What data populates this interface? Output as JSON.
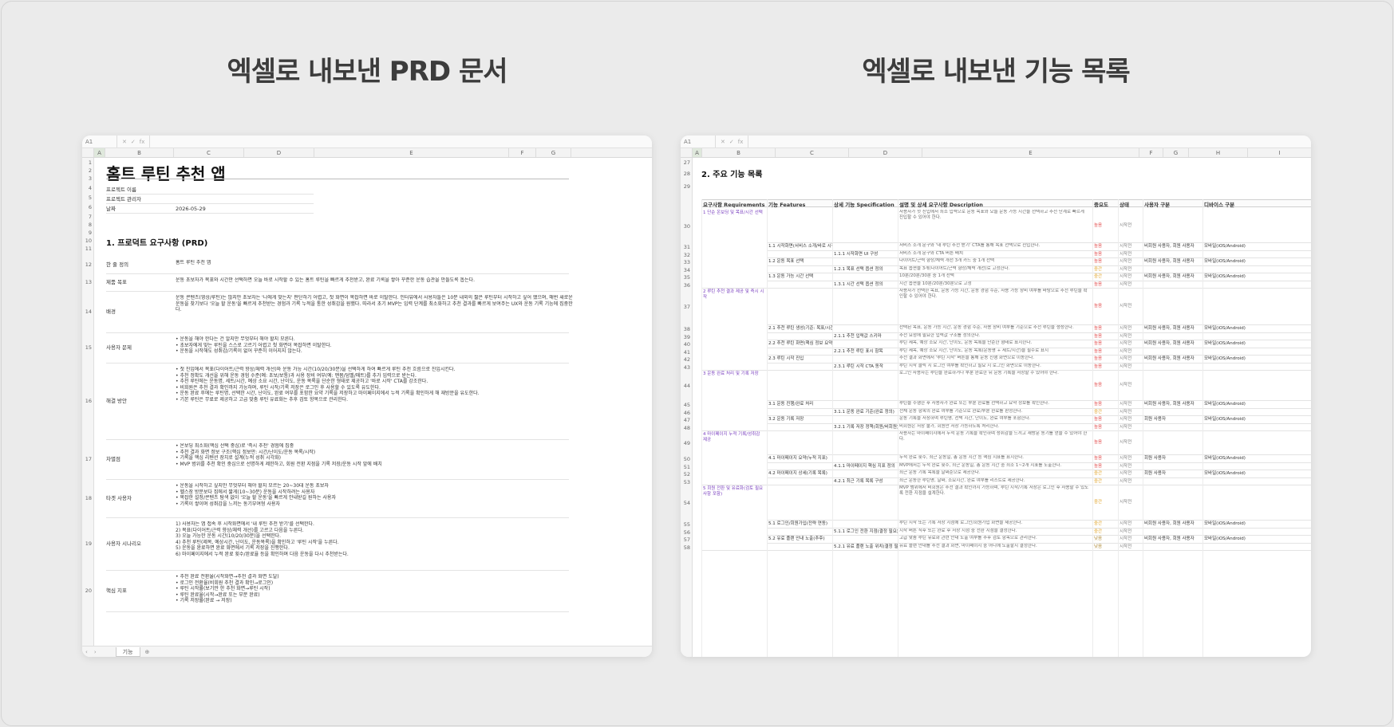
{
  "titles": {
    "left": "엑셀로 내보낸 PRD 문서",
    "right": "엑셀로 내보낸 기능 목록"
  },
  "left_sheet": {
    "cell_ref": "A1",
    "formula_icons": [
      "✕",
      "✓",
      "fx"
    ],
    "columns": [
      "A",
      "B",
      "C",
      "D",
      "E",
      "F",
      "G"
    ],
    "doc_title": "홈트 루틴 추천 앱",
    "meta": [
      {
        "label": "프로젝트 이름",
        "value": ""
      },
      {
        "label": "프로젝트 관리자",
        "value": ""
      },
      {
        "label": "날짜",
        "value": "2026-05-29"
      }
    ],
    "section_title": "1. 프로덕트 요구사항 (PRD)",
    "rows": [
      {
        "n": "12",
        "label": "한 줄 정의",
        "text": "홈트 루틴 추천 앱"
      },
      {
        "n": "13",
        "label": "제품 목표",
        "text": "운동 초보자가 목표와 시간만 선택하면 오늘 바로 시작할 수 있는 홈트 루틴을 빠르게 추천받고, 완료 기록을 쌓아 꾸준한 운동 습관을 만들도록 돕는다."
      },
      {
        "n": "14",
        "label": "배경",
        "text": "운동 콘텐츠(영상/루틴)는 많지만 초보자는 '나에게 맞는지' 판단하기 어렵고, 첫 화면이 복잡하면 바로 이탈한다. 인터뷰에서 사용자들은 10분 내외의 짧은 루틴부터 시작하고 싶어 했으며, 매번 새로운 운동을 찾기보다 '오늘 할 운동'을 빠르게 추천받는 경험과 기록 누적을 통한 성취감을 원했다. 따라서 초기 MVP는 입력 단계를 최소화하고 추천 결과를 빠르게 보여주는 UX와 운동 기록 기능에 집중한다."
      },
      {
        "n": "15",
        "label": "사용자 문제",
        "text": "• 운동을 해야 한다는 건 알지만 무엇부터 해야 할지 모른다.\n• 초보자에게 맞는 루틴을 스스로 고르기 어렵고 첫 화면이 복잡하면 이탈한다.\n• 운동을 시작해도 성취감/기록이 없어 꾸준히 이어지지 않는다."
      },
      {
        "n": "16",
        "label": "해결 방안",
        "text": "• 첫 진입에서 목표(다이어트/근력 향상/체력 개선)와 운동 가능 시간(10/20/30분)을 선택하게 하여 빠르게 루틴 추천 흐름으로 진입시킨다.\n• 추천 정확도 개선을 위해 운동 경험 수준(예: 초보/보통)과 사용 장비 여부(예: 맨몸/덤벨/매트)를 추가 입력으로 받는다.\n• 추천 루틴에는 운동명, 세트/시간, 예상 소요 시간, 난이도, 운동 목록을 단순한 형태로 제공하고 '바로 시작' CTA를 강조한다.\n• 비회원은 추천 결과 확인까지 가능하며, 루틴 시작/기록 저장은 로그인 후 사용할 수 있도록 유도한다.\n• 운동 완료 후에는 루틴명, 선택한 시간, 난이도, 완료 여부를 포함한 요약 기록을 저장하고 마이페이지에서 누적 기록을 확인하게 해 재방문을 유도한다.\n• 기본 루틴은 무료로 제공하고 고급 맞춤 루틴 유료화는 추후 검토 항목으로 관리한다."
      },
      {
        "n": "17",
        "label": "차별점",
        "text": "• 온보딩 최소화(핵심 선택 중심)로 '즉시 추천' 경험에 집중\n• 추천 결과 화면 정보 구조(핵심 정보만: 시간/난이도/운동 목록/시작)\n• 기록을 핵심 리텐션 장치로 설계(누적 성취 시각화)\n• MVP 범위를 추천 확인 중심으로 선명하게 제한하고, 회원 전환 지점을 기록 저장/운동 시작 앞에 배치"
      },
      {
        "n": "18",
        "label": "타겟 사용자",
        "text": "• 운동을 시작하고 싶지만 무엇부터 해야 할지 모르는 20~30대 운동 초보자\n• 헬스장 방문보다 집에서 짧게(10~30분) 운동을 시작하려는 사용자\n• 복잡한 설정/콘텐츠 탐색 없이 '오늘 할 운동'을 빠르게 안내받길 원하는 사용자\n• 기록이 쌓이며 성취감을 느끼는 동기부여형 사용자"
      },
      {
        "n": "19",
        "label": "사용자 시나리오",
        "text": "1) 사용자는 앱 접속 후 시작화면에서 '내 루틴 추천 받기'를 선택한다.\n2) 목표(다이어트/근력 향상/체력 개선)를 고르고 다음을 누른다.\n3) 오늘 가능한 운동 시간(10/20/30분)을 선택한다.\n4) 추천 루틴(제목, 예상시간, 난이도, 운동목록)을 확인하고 '루틴 시작'을 누른다.\n5) 운동을 완료하면 완료 화면에서 기록 저장을 진행한다.\n6) 마이페이지에서 누적 완료 횟수/완료율 등을 확인하며 다음 운동을 다시 추천받는다."
      },
      {
        "n": "20",
        "label": "핵심 지표",
        "text": "• 추천 완료 전환율(시작화면→추천 결과 화면 도달)\n• 로그인 전환율(비회원 추천 결과 확인→로그인)\n• 루틴 시작률(보기만 한 추천 화면→루틴 시작)\n• 루틴 완료율(시작→완료 또는 부분 완료)\n• 기록 저장률(완료 → 저장)"
      }
    ],
    "row_numbers": [
      "1",
      "2",
      "3",
      "4",
      "5",
      "6",
      "7",
      "8",
      "9",
      "10",
      "11"
    ],
    "sheet_tab": "기능"
  },
  "right_sheet": {
    "cell_ref": "A1",
    "formula_icons": [
      "✕",
      "✓",
      "fx"
    ],
    "columns": [
      "A",
      "B",
      "C",
      "D",
      "E",
      "F",
      "G",
      "H",
      "I"
    ],
    "section_title": "2. 주요 기능 목록",
    "headers": [
      "요구사항 Requirements",
      "기능 Features",
      "상세 기능 Specification",
      "설명 및 상세 요구사항 Description",
      "중요도",
      "상태",
      "사용자 구분",
      "디바이스 구분"
    ],
    "top_row_numbers": [
      "27",
      "28",
      "29"
    ],
    "groups": [
      {
        "req": "1 단순 온보딩 및 목표/시간 선택",
        "rows": [
          {
            "n": "30",
            "feature": "",
            "spec": "",
            "desc": "사용자가 첫 진입에서 최소 입력으로 운동 목표와 오늘 운동 가능 시간을 선택하고 추천 단계로 빠르게 진입할 수 있어야 한다.",
            "prio": "높음",
            "status": "시작전",
            "user": "",
            "device": ""
          },
          {
            "n": "31",
            "feature": "1.1 시작화면(서비스 소개/바로 시작)",
            "spec": "",
            "desc": "서비스 소개 문구와 '내 루틴 추천 받기' CTA를 통해 목표 선택으로 진입한다.",
            "prio": "높음",
            "status": "시작전",
            "user": "비회원 사용자, 회원 사용자",
            "device": "모바일(iOS/Android)"
          },
          {
            "n": "32",
            "feature": "",
            "spec": "1.1.1 시작화면 UI 구성",
            "desc": "서비스 소개 문구와 CTA 버튼 배치",
            "prio": "높음",
            "status": "시작전",
            "user": "",
            "device": ""
          },
          {
            "n": "33",
            "feature": "1.2 운동 목표 선택",
            "spec": "",
            "desc": "다이어트/근력 향상/체력 개선 3개 카드 중 1개 선택",
            "prio": "높음",
            "status": "시작전",
            "user": "비회원 사용자, 회원 사용자",
            "device": "모바일(iOS/Android)"
          },
          {
            "n": "34",
            "feature": "",
            "spec": "1.2.1 목표 선택 옵션 정의",
            "desc": "목표 옵션을 3개(다이어트/근력 향상/체력 개선)로 고정한다.",
            "prio": "중간",
            "status": "시작전",
            "user": "",
            "device": ""
          },
          {
            "n": "35",
            "feature": "1.3 운동 가능 시간 선택",
            "spec": "",
            "desc": "10분/20분/30분 중 1개 선택",
            "prio": "중간",
            "status": "시작전",
            "user": "비회원 사용자, 회원 사용자",
            "device": "모바일(iOS/Android)"
          },
          {
            "n": "36",
            "feature": "",
            "spec": "1.3.1 시간 선택 옵션 정의",
            "desc": "시간 옵션을 10분/20분/30분으로 고정",
            "prio": "높음",
            "status": "시작전",
            "user": "",
            "device": ""
          }
        ]
      },
      {
        "req": "2 루틴 추천 결과 제공 및 즉시 시작",
        "rows": [
          {
            "n": "37",
            "feature": "",
            "spec": "",
            "desc": "사용자가 선택한 목표, 운동 가능 시간, 운동 경험 수준, 사용 가능 장비 여부를 바탕으로 추천 루틴을 확인할 수 있어야 한다.",
            "prio": "높음",
            "status": "시작전",
            "user": "",
            "device": ""
          },
          {
            "n": "38",
            "feature": "2.1 추천 루틴 생성(기준: 목표/시간)",
            "spec": "",
            "desc": "선택된 목표, 운동 가능 시간, 운동 경험 수준, 사용 장비 여부를 기준으로 추천 루틴을 생성한다.",
            "prio": "높음",
            "status": "시작전",
            "user": "비회원 사용자, 회원 사용자",
            "device": "모바일(iOS/Android)"
          },
          {
            "n": "39",
            "feature": "",
            "spec": "2.1.1 추천 입력값 스키마",
            "desc": "추천 요청에 필요한 입력값 구조를 정의한다.",
            "prio": "높음",
            "status": "시작전",
            "user": "",
            "device": ""
          },
          {
            "n": "40",
            "feature": "2.2 추천 루틴 화면(핵심 정보 요약)",
            "spec": "",
            "desc": "루틴 제목, 예상 소요 시간, 난이도, 운동 목록을 단순한 형태로 표시한다.",
            "prio": "높음",
            "status": "시작전",
            "user": "비회원 사용자, 회원 사용자",
            "device": "모바일(iOS/Android)"
          },
          {
            "n": "41",
            "feature": "",
            "spec": "2.2.1 추천 루틴 표시 항목",
            "desc": "루틴 제목, 예상 소요 시간, 난이도, 운동 목록(운동명 + 세트/시간)을 필수로 표시",
            "prio": "높음",
            "status": "시작전",
            "user": "",
            "device": ""
          },
          {
            "n": "42",
            "feature": "2.3 루틴 시작 진입",
            "spec": "",
            "desc": "추천 결과 화면에서 '루틴 시작' 버튼을 통해 운동 진행 화면으로 이동한다.",
            "prio": "높음",
            "status": "시작전",
            "user": "비회원 사용자, 회원 사용자",
            "device": "모바일(iOS/Android)"
          },
          {
            "n": "43",
            "feature": "",
            "spec": "2.3.1 루틴 시작 CTA 동작",
            "desc": "루틴 시작 클릭 시 로그인 여부를 확인하고 필요 시 로그인 화면으로 이동한다.",
            "prio": "높음",
            "status": "시작전",
            "user": "",
            "device": ""
          }
        ]
      },
      {
        "req": "3 운동 완료 처리 및 기록 저장",
        "rows": [
          {
            "n": "44",
            "feature": "",
            "spec": "",
            "desc": "로그인 사용자는 루틴을 완료하거나 부분 완료한 뒤 운동 기록을 저장할 수 있어야 한다.",
            "prio": "높음",
            "status": "시작전",
            "user": "",
            "device": ""
          },
          {
            "n": "45",
            "feature": "3.1 운동 진행/완료 처리",
            "spec": "",
            "desc": "루틴을 수행한 후 사용자가 완료 또는 부분 완료를 선택하고 요약 정보를 확인한다.",
            "prio": "높음",
            "status": "시작전",
            "user": "비회원 사용자, 회원 사용자",
            "device": "모바일(iOS/Android)"
          },
          {
            "n": "46",
            "feature": "",
            "spec": "3.1.1 운동 완료 기준(완료 정의)",
            "desc": "전체 운동 항목의 완료 여부를 기준으로 완료/부분 완료를 판정한다.",
            "prio": "중간",
            "status": "시작전",
            "user": "",
            "device": ""
          },
          {
            "n": "47",
            "feature": "3.2 운동 기록 저장",
            "spec": "",
            "desc": "운동 기록을 저장하며 루틴명, 선택 시간, 난이도, 완료 여부를 포함한다.",
            "prio": "높음",
            "status": "시작전",
            "user": "회원 사용자",
            "device": "모바일(iOS/Android)"
          },
          {
            "n": "48",
            "feature": "",
            "spec": "3.2.1 기록 저장 정책(회원/비회원)",
            "desc": "비회원은 저장 불가, 회원만 저장 가능하도록 처리한다.",
            "prio": "높음",
            "status": "시작전",
            "user": "",
            "device": ""
          }
        ]
      },
      {
        "req": "4 마이페이지 누적 기록/성취감 제공",
        "rows": [
          {
            "n": "49",
            "feature": "",
            "spec": "",
            "desc": "사용자는 마이페이지에서 누적 운동 기록을 확인하며 성취감을 느끼고 재방문 동기를 얻을 수 있어야 한다.",
            "prio": "높음",
            "status": "시작전",
            "user": "",
            "device": ""
          },
          {
            "n": "50",
            "feature": "4.1 마이페이지 요약(누적 지표)",
            "spec": "",
            "desc": "누적 완료 횟수, 최근 운동일, 총 운동 시간 등 핵심 지표를 표시한다.",
            "prio": "높음",
            "status": "시작전",
            "user": "회원 사용자",
            "device": "모바일(iOS/Android)"
          },
          {
            "n": "51",
            "feature": "",
            "spec": "4.1.1 마이페이지 핵심 지표 정의",
            "desc": "MVP에서는 누적 완료 횟수, 최근 운동일, 총 운동 시간 중 최소 1~2개 지표를 노출한다.",
            "prio": "높음",
            "status": "시작전",
            "user": "",
            "device": ""
          },
          {
            "n": "52",
            "feature": "4.2 마이페이지 상세(기록 목록)",
            "spec": "",
            "desc": "최근 운동 기록 목록을 날짜순으로 제공한다.",
            "prio": "중간",
            "status": "시작전",
            "user": "회원 사용자",
            "device": "모바일(iOS/Android)"
          },
          {
            "n": "53",
            "feature": "",
            "spec": "4.2.1 최근 기록 목록 구성",
            "desc": "최근 운동한 루틴명, 날짜, 소요시간, 완료 여부를 리스트로 제공한다.",
            "prio": "중간",
            "status": "시작전",
            "user": "",
            "device": ""
          }
        ]
      },
      {
        "req": "5 회원 전환 및 유료화(검토 필요 사항 포함)",
        "rows": [
          {
            "n": "54",
            "feature": "",
            "spec": "",
            "desc": "MVP 범위에서 비회원은 추천 결과 확인까지 가능하며, 루틴 시작/기록 저장은 로그인 후 사용할 수 있도록 전환 지점을 설계한다.",
            "prio": "중간",
            "status": "시작전",
            "user": "",
            "device": ""
          },
          {
            "n": "55",
            "feature": "5.1 로그인/회원가입(전략 연동)",
            "spec": "",
            "desc": "루틴 시작 또는 기록 저장 시점에 로그인/회원가입 화면을 제공한다.",
            "prio": "중간",
            "status": "시작전",
            "user": "비회원 사용자, 회원 사용자",
            "device": "모바일(iOS/Android)"
          },
          {
            "n": "56",
            "feature": "",
            "spec": "5.1.1 로그인 전환 지점(결정 필요)",
            "desc": "시작 버튼 직후 또는 완료 후 저장 시점 중 전환 지점을 결정한다.",
            "prio": "중간",
            "status": "시작전",
            "user": "",
            "device": ""
          },
          {
            "n": "57",
            "feature": "5.2 유료 플랜 안내 노출(추후)",
            "spec": "",
            "desc": "고급 맞춤 루틴 유료화 관련 안내 노출 여부를 추후 검토 항목으로 관리한다.",
            "prio": "낮음",
            "status": "시작전",
            "user": "비회원 사용자, 회원 사용자",
            "device": "모바일(iOS/Android)"
          },
          {
            "n": "58",
            "feature": "",
            "spec": "5.2.1 유료 플랜 노출 위치(결정 필요)",
            "desc": "유료 플랜 안내를 추천 결과 화면, 마이페이지 중 어디에 노출할지 결정한다.",
            "prio": "낮음",
            "status": "시작전",
            "user": "",
            "device": ""
          }
        ]
      }
    ]
  },
  "colors": {
    "requirement": "#7a3fbf",
    "priority_high": "#e34a4a",
    "priority_mid": "#e0a020",
    "priority_low": "#b08c3a"
  }
}
